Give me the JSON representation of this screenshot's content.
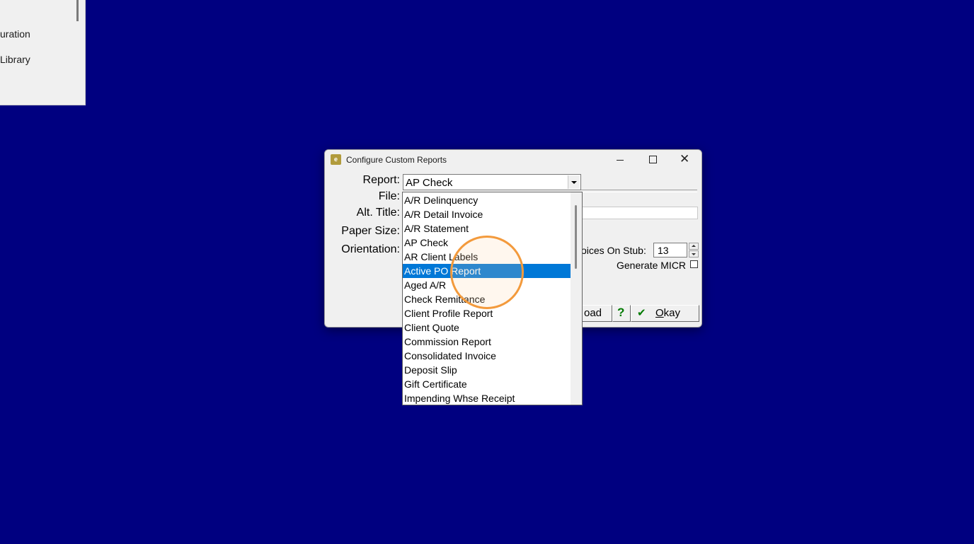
{
  "background_window": {
    "items": [
      "uration",
      "Library"
    ]
  },
  "dialog": {
    "title": "Configure Custom Reports",
    "icon_text": "e",
    "labels": {
      "report": "Report:",
      "file": "File:",
      "alt_title": "Alt. Title:",
      "paper_size": "Paper Size:",
      "orientation": "Orientation:"
    },
    "report_value": "AP Check",
    "invoices_label": "oices On Stub:",
    "invoices_value": "13",
    "micr_label": "Generate MICR",
    "load_label": "oad",
    "help_label": "?",
    "okay_label": "Okay"
  },
  "dropdown": {
    "items": [
      "A/R Delinquency",
      "A/R Detail Invoice",
      "A/R Statement",
      "AP Check",
      "AR Client Labels",
      "Active PO Report",
      "Aged A/R",
      "Check Remittance",
      "Client Profile Report",
      "Client Quote",
      "Commission Report",
      "Consolidated Invoice",
      "Deposit Slip",
      "Gift Certificate",
      "Impending Whse Receipt"
    ],
    "selected": "Active PO Report"
  },
  "colors": {
    "desktop": "#000080",
    "selection": "#0078d7",
    "highlight_ring": "#f39a3c",
    "help_green": "#007a00"
  }
}
